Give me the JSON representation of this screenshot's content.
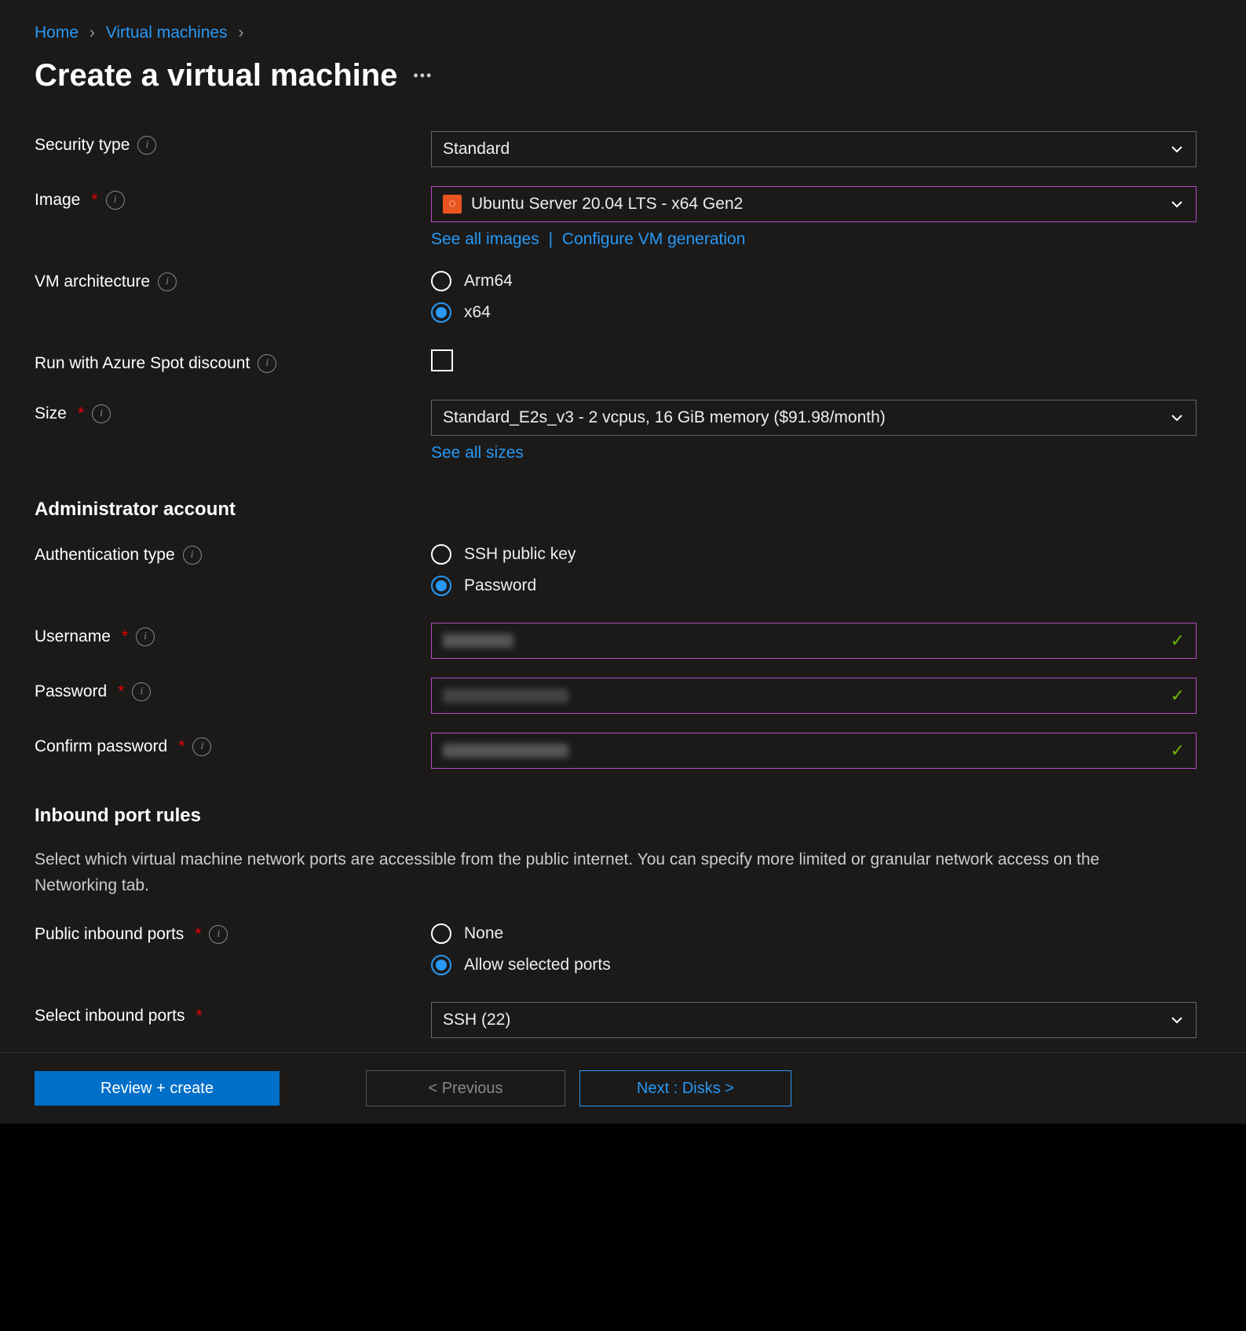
{
  "breadcrumbs": {
    "home": "Home",
    "vms": "Virtual machines"
  },
  "title": "Create a virtual machine",
  "labels": {
    "security_type": "Security type",
    "image": "Image",
    "vm_arch": "VM architecture",
    "spot": "Run with Azure Spot discount",
    "size": "Size",
    "auth_type": "Authentication type",
    "username": "Username",
    "password": "Password",
    "confirm_password": "Confirm password",
    "public_inbound": "Public inbound ports",
    "select_inbound": "Select inbound ports"
  },
  "values": {
    "security_type": "Standard",
    "image": "Ubuntu Server 20.04 LTS - x64 Gen2",
    "size": "Standard_E2s_v3 - 2 vcpus, 16 GiB memory ($91.98/month)",
    "select_inbound": "SSH (22)"
  },
  "links": {
    "see_all_images": "See all images",
    "configure_gen": "Configure VM generation",
    "see_all_sizes": "See all sizes"
  },
  "arch": {
    "arm64": "Arm64",
    "x64": "x64",
    "selected": "x64"
  },
  "spot_checked": false,
  "auth": {
    "ssh": "SSH public key",
    "password": "Password",
    "selected": "password"
  },
  "sections": {
    "admin": "Administrator account",
    "inbound": "Inbound port rules"
  },
  "inbound_desc": "Select which virtual machine network ports are accessible from the public internet. You can specify more limited or granular network access on the Networking tab.",
  "inbound": {
    "none": "None",
    "allow": "Allow selected ports",
    "selected": "allow"
  },
  "footer": {
    "review": "Review + create",
    "previous": "< Previous",
    "next": "Next : Disks >"
  }
}
